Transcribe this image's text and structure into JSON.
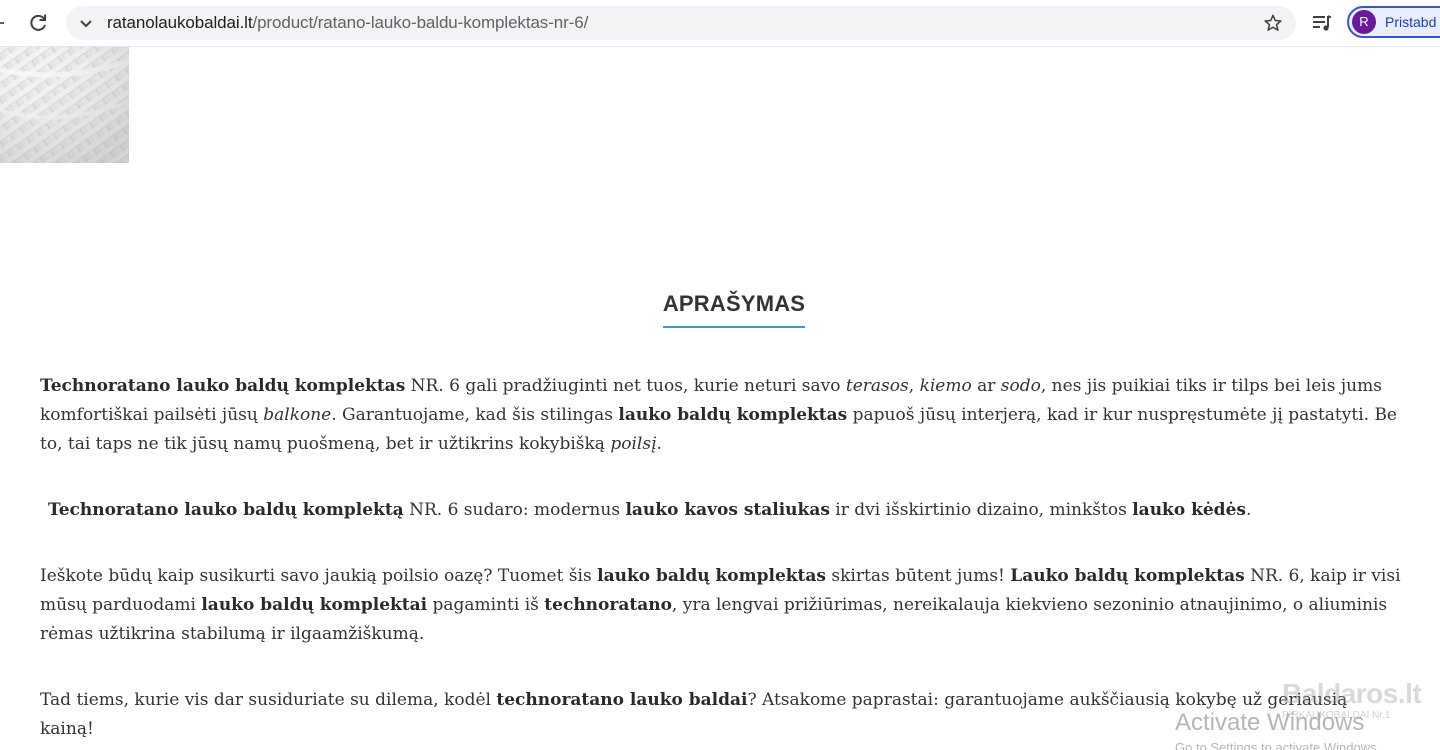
{
  "browser": {
    "url_host": "ratanolaukobaldai.lt",
    "url_path": "/product/ratano-lauko-baldu-komplektas-nr-6/",
    "profile_initial": "R",
    "profile_label": "Pristabd"
  },
  "product": {
    "heading": "APRAŠYMAS",
    "description": [
      {
        "segments": [
          {
            "text": "Technoratano lauko baldų komplektas",
            "style": "bold"
          },
          {
            "text": " NR. 6 gali pradžiuginti net tuos, kurie neturi savo ",
            "style": "normal"
          },
          {
            "text": "terasos",
            "style": "italic"
          },
          {
            "text": ", ",
            "style": "normal"
          },
          {
            "text": "kiemo",
            "style": "italic"
          },
          {
            "text": " ar ",
            "style": "normal"
          },
          {
            "text": "sodo",
            "style": "italic"
          },
          {
            "text": ", nes jis puikiai tiks ir tilps bei leis jums komfortiškai pailsėti jūsų ",
            "style": "normal"
          },
          {
            "text": "balkone",
            "style": "italic"
          },
          {
            "text": ". Garantuojame, kad šis stilingas ",
            "style": "normal"
          },
          {
            "text": "lauko baldų komplektas",
            "style": "bold"
          },
          {
            "text": " papuoš jūsų interjerą, kad ir kur nuspręstumėte jį pastatyti. Be to, tai taps ne tik jūsų namų puošmeną, bet ir užtikrins kokybišką ",
            "style": "normal"
          },
          {
            "text": "poilsį",
            "style": "italic"
          },
          {
            "text": ".",
            "style": "normal"
          }
        ]
      },
      {
        "segments": [
          {
            "text": "Technoratano lauko baldų komplektą",
            "style": "bold"
          },
          {
            "text": " NR. 6 sudaro: modernus ",
            "style": "normal"
          },
          {
            "text": "lauko kavos staliukas",
            "style": "bold"
          },
          {
            "text": " ir dvi išskirtinio dizaino, minkštos ",
            "style": "normal"
          },
          {
            "text": "lauko kėdės",
            "style": "bold"
          },
          {
            "text": ".",
            "style": "normal"
          }
        ]
      },
      {
        "segments": [
          {
            "text": "Ieškote būdų kaip susikurti savo jaukią poilsio oazę? Tuomet šis ",
            "style": "normal"
          },
          {
            "text": "lauko baldų komplektas",
            "style": "bold"
          },
          {
            "text": " skirtas būtent jums! ",
            "style": "normal"
          },
          {
            "text": "Lauko baldų komplektas",
            "style": "bold"
          },
          {
            "text": " NR. 6, kaip ir visi mūsų parduodami ",
            "style": "normal"
          },
          {
            "text": "lauko baldų komplektai",
            "style": "bold"
          },
          {
            "text": " pagaminti iš ",
            "style": "normal"
          },
          {
            "text": "technoratano",
            "style": "bold"
          },
          {
            "text": ", yra lengvai prižiūrimas, nereikalauja kiekvieno sezoninio atnaujinimo, o aliuminis rėmas užtikrina stabilumą ir ilgaamžiškumą.",
            "style": "normal"
          }
        ]
      },
      {
        "segments": [
          {
            "text": "Tad tiems, kurie vis dar susiduriate su dilema, kodėl ",
            "style": "normal"
          },
          {
            "text": "technoratano lauko baldai",
            "style": "bold"
          },
          {
            "text": "? Atsakome paprastai: garantuojame aukščiausią kokybę už geriausią kainą!",
            "style": "normal"
          }
        ]
      }
    ]
  },
  "overlays": {
    "watermark_logo": "Baldaros.lt",
    "watermark_logo_sub": "PIRKAUKOBALDAI  Nr.1",
    "os_activation_title": "Activate Windows",
    "os_activation_sub": "Go to Settings to activate Windows."
  },
  "colors": {
    "accent_underline": "#2f9fd8",
    "text": "#333333",
    "profile_border": "#3b57c7",
    "avatar_bg": "#6a1b9a"
  },
  "icons": {
    "back": "back-arrow-icon",
    "reload": "reload-icon",
    "site_info": "chevron-down-icon",
    "bookmark": "star-icon",
    "media": "media-queue-icon"
  }
}
